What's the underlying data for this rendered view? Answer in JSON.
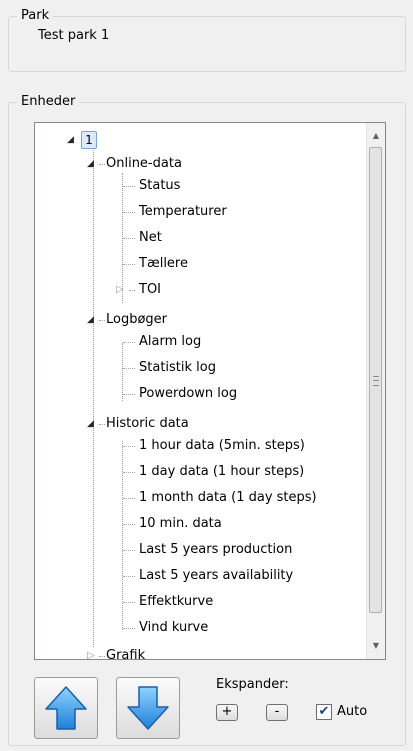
{
  "park": {
    "legend": "Park",
    "name": "Test park 1"
  },
  "units": {
    "legend": "Enheder",
    "root_label": "1",
    "groups": [
      {
        "label": "Online-data",
        "items": [
          "Status",
          "Temperaturer",
          "Net",
          "Tællere",
          "TOI"
        ]
      },
      {
        "label": "Logbøger",
        "items": [
          "Alarm log",
          "Statistik log",
          "Powerdown log"
        ]
      },
      {
        "label": "Historic data",
        "items": [
          "1 hour data (5min. steps)",
          "1 day data (1 hour steps)",
          "1 month data (1 day steps)",
          "10 min. data",
          "Last 5 years production",
          "Last 5 years availability",
          "Effektkurve",
          "Vind kurve"
        ]
      },
      {
        "label": "Grafik"
      }
    ]
  },
  "controls": {
    "expand_label": "Ekspander:",
    "plus_label": "+",
    "minus_label": "-",
    "auto_label": "Auto",
    "auto_checked": true
  },
  "icons": {
    "up": "up-arrow-icon",
    "down": "down-arrow-icon",
    "accent": "#2b8fe6"
  }
}
